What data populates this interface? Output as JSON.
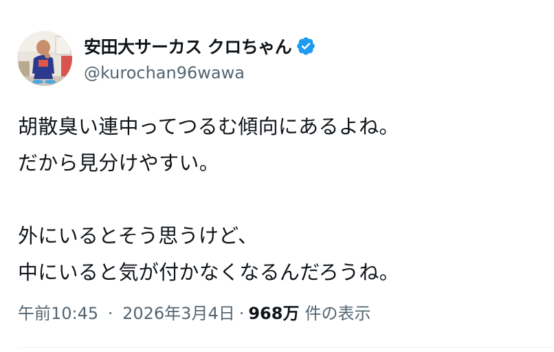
{
  "user": {
    "display_name": "安田大サーカス クロちゃん",
    "handle": "@kurochan96wawa",
    "verified": true,
    "verified_color": "#1d9bf0"
  },
  "tweet": {
    "text": "胡散臭い連中ってつるむ傾向にあるよね。\nだから見分けやすい。\n\n外にいるとそう思うけど、\n中にいると気が付かなくなるんだろうね。",
    "time": "午前10:45",
    "date": "2026年3月4日",
    "separator": "·",
    "views_count": "968万",
    "views_label": "件の表示"
  },
  "colors": {
    "text_primary": "#0f1419",
    "text_secondary": "#536471"
  }
}
